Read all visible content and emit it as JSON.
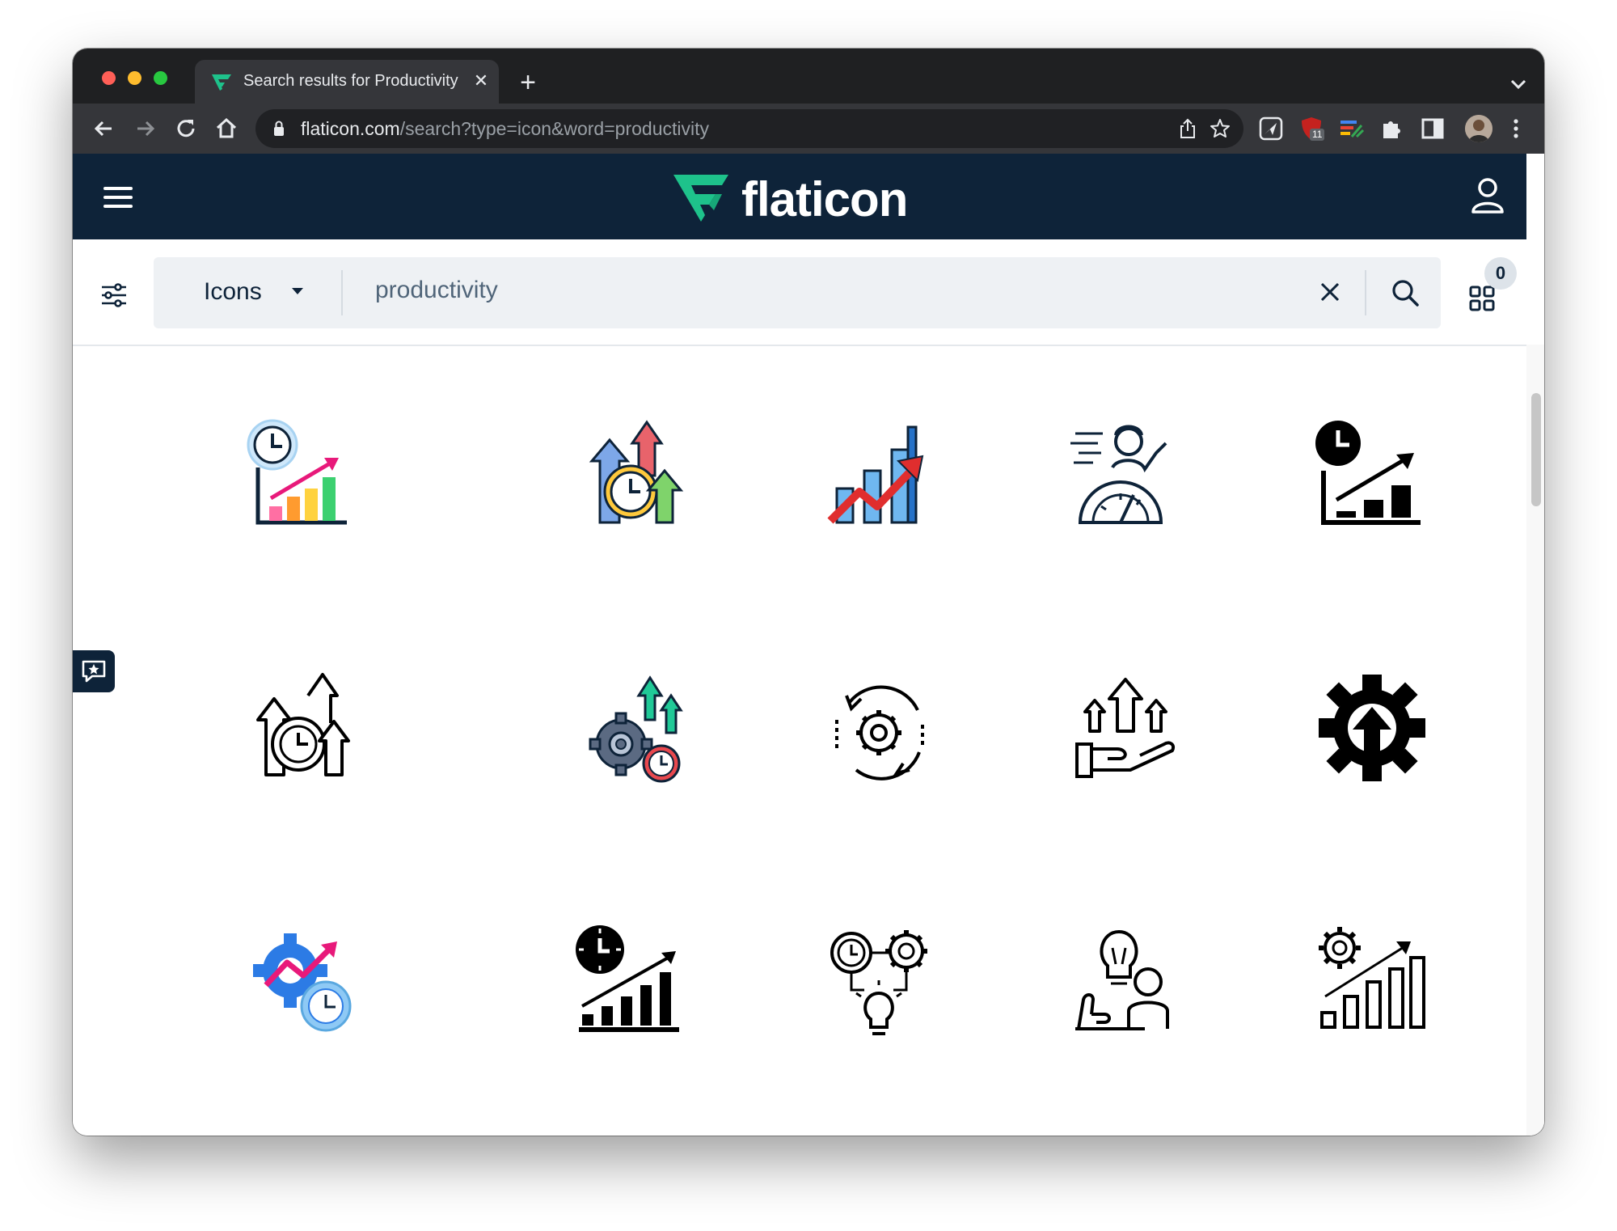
{
  "browser": {
    "tab_title": "Search results for Productivity",
    "tab_close": "✕",
    "new_tab": "+",
    "url_domain": "flaticon.com",
    "url_path": "/search?type=icon&word=productivity",
    "extension_badge": "11"
  },
  "site": {
    "logo_text": "flaticon",
    "search": {
      "type_label": "Icons",
      "query": "productivity"
    },
    "collection_count": "0"
  },
  "colors": {
    "header_bg": "#0e2339",
    "brand_green": "#1ec28b",
    "search_bg": "#eef1f4"
  },
  "icons": [
    {
      "name": "time-growth-chart-icon"
    },
    {
      "name": "clock-growth-arrows-icon"
    },
    {
      "name": "bar-chart-trend-icon"
    },
    {
      "name": "fast-worker-icon"
    },
    {
      "name": "clock-bar-chart-icon"
    },
    {
      "name": "clock-arrows-outline-icon"
    },
    {
      "name": "gear-arrows-clock-icon"
    },
    {
      "name": "gear-cycle-icon"
    },
    {
      "name": "hand-arrows-icon"
    },
    {
      "name": "gear-upload-icon"
    },
    {
      "name": "gear-trend-clock-icon"
    },
    {
      "name": "clock-stairs-chart-icon"
    },
    {
      "name": "clock-gear-bulb-icon"
    },
    {
      "name": "person-idea-icon"
    },
    {
      "name": "gear-chart-outline-icon"
    }
  ]
}
